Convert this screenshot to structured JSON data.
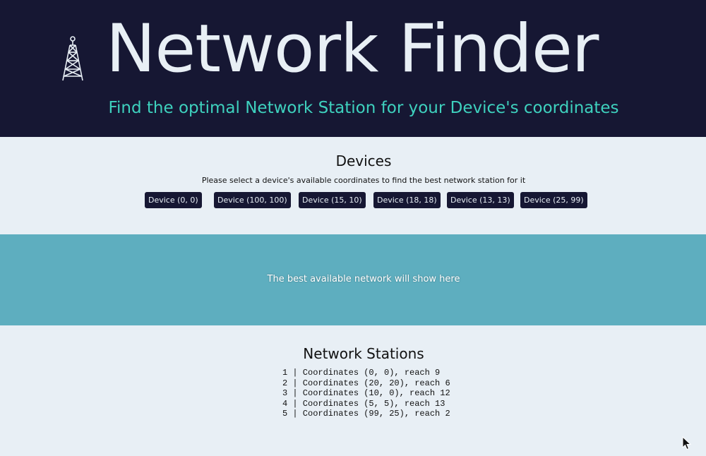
{
  "header": {
    "title": "Network Finder",
    "subtitle": "Find the optimal Network Station for your Device's coordinates",
    "icon": "radio-tower-icon"
  },
  "devices": {
    "heading": "Devices",
    "help_text": "Please select a device's available coordinates to find the best network station for it",
    "buttons": [
      "Device (0, 0)",
      "Device (100, 100)",
      "Device (15, 10)",
      "Device (18, 18)",
      "Device (13, 13)",
      "Device (25, 99)"
    ]
  },
  "result": {
    "placeholder": "The best available network will show here"
  },
  "stations": {
    "heading": "Network Stations",
    "items": [
      "1 | Coordinates (0, 0), reach 9",
      "2 | Coordinates (20, 20), reach 6",
      "3 | Coordinates (10, 0), reach 12",
      "4 | Coordinates (5, 5), reach 13",
      "5 | Coordinates (99, 25), reach 2"
    ]
  },
  "colors": {
    "header_bg": "#161733",
    "title_text": "#e8eff5",
    "subtitle_text": "#3ed1be",
    "page_bg": "#e8eff5",
    "result_bg": "#5eaebf",
    "button_bg": "#161733",
    "button_text": "#e8eff5"
  }
}
